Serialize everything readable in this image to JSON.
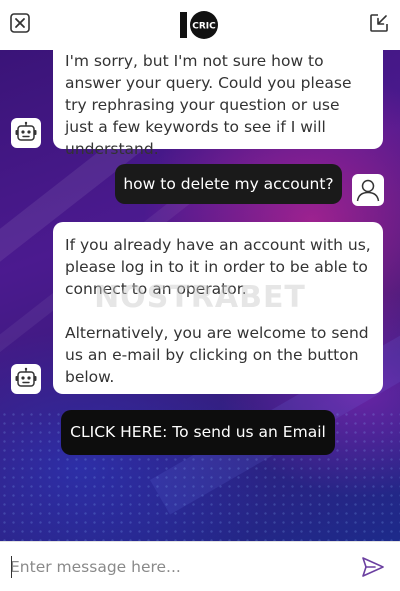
{
  "header": {
    "close_icon": "close-icon",
    "popout_icon": "popout-icon",
    "logo_text": "CRIC"
  },
  "messages": [
    {
      "sender": "bot",
      "lines": [
        "I'm sorry, but I'm not sure how to answer your query. Could you please try rephrasing your question or use just a few keywords to see if I will understand."
      ]
    },
    {
      "sender": "user",
      "text": "how to delete my account?"
    },
    {
      "sender": "bot",
      "paragraphs": [
        "If you already have an account with us, please log in to it in order to be able to connect to an operator.",
        "Alternatively, you are welcome to send us an e-mail by clicking on the button below."
      ]
    }
  ],
  "cta": {
    "label": "CLICK HERE: To send us an Email"
  },
  "watermark": "NOSTRABET",
  "composer": {
    "placeholder": "Enter message here...",
    "send_icon": "send-icon"
  },
  "colors": {
    "bubble_bot": "#ffffff",
    "bubble_user": "#1a1a1a",
    "cta_button": "#0d0d0d",
    "background_purple": "#4b1a8f",
    "send_icon": "#6b3fa0"
  }
}
